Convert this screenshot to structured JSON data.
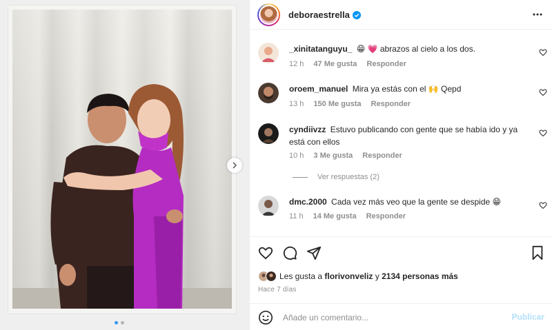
{
  "post": {
    "username": "deboraestrella",
    "verified": true,
    "more_icon": "more-horizontal-icon",
    "carousel": {
      "total_slides": 2,
      "current_slide": 1
    }
  },
  "comments": [
    {
      "username": "_xinitatanguyu_",
      "text": "😁 💗 abrazos al cielo a los dos.",
      "time": "12 h",
      "likes": "47 Me gusta",
      "reply": "Responder"
    },
    {
      "username": "oroem_manuel",
      "text": "Mira ya estás con el 🙌 Qepd",
      "time": "13 h",
      "likes": "150 Me gusta",
      "reply": "Responder"
    },
    {
      "username": "cyndiivzz",
      "text": "Estuvo publicando con gente que se había ido y ya está con ellos",
      "time": "10 h",
      "likes": "3 Me gusta",
      "reply": "Responder",
      "view_replies": "Ver respuestas (2)"
    },
    {
      "username": "dmc.2000",
      "text": "Cada vez más veo que la gente se despide 😁",
      "time": "11 h",
      "likes": "14 Me gusta",
      "reply": "Responder"
    }
  ],
  "likes": {
    "prefix": "Les gusta a",
    "user": "florivonveliz",
    "connector": "y",
    "others": "2134 personas más"
  },
  "time_ago": "Hace 7 días",
  "comment_box": {
    "placeholder": "Añade un comentario...",
    "post_label": "Publicar"
  },
  "colors": {
    "accent_blue": "#0095f6",
    "post_disabled": "#b2dffc",
    "secondary_text": "#8e8e8e",
    "primary_text": "#262626"
  }
}
